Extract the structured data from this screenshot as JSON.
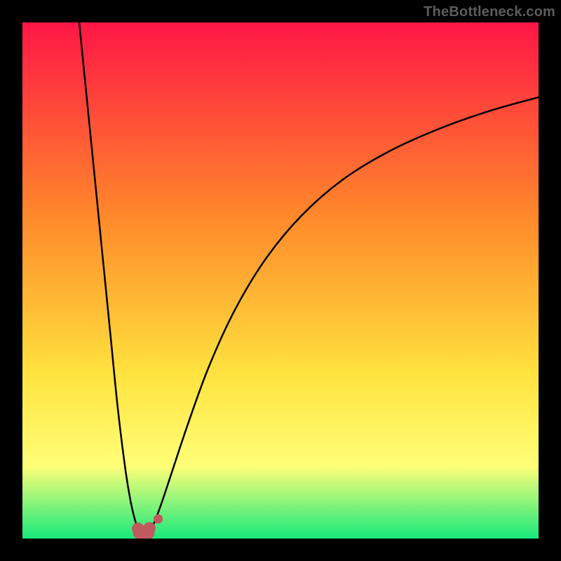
{
  "watermark": "TheBottleneck.com",
  "chart_data": {
    "type": "line",
    "title": "",
    "xlabel": "",
    "ylabel": "",
    "xlim": [
      0,
      100
    ],
    "ylim": [
      0,
      100
    ],
    "background_gradient": {
      "top": "#ff1646",
      "mid1": "#ff8a2a",
      "mid2": "#ffe23e",
      "mid3": "#ffff78",
      "bottom": "#17e97c"
    },
    "series": [
      {
        "name": "left-curve",
        "stroke": "#000000",
        "x": [
          11.0,
          13.0,
          15.0,
          17.0,
          18.5,
          20.0,
          21.0,
          21.7,
          22.3,
          22.7
        ],
        "values": [
          100.0,
          80.0,
          60.0,
          40.0,
          25.0,
          13.0,
          7.0,
          4.0,
          2.0,
          0.8
        ]
      },
      {
        "name": "right-curve",
        "stroke": "#000000",
        "x": [
          24.5,
          25.5,
          27.0,
          29.0,
          32.0,
          36.0,
          41.0,
          47.0,
          54.0,
          62.0,
          71.0,
          81.0,
          91.0,
          100.0
        ],
        "values": [
          1.0,
          3.0,
          7.0,
          13.0,
          22.0,
          33.0,
          44.0,
          54.0,
          62.5,
          69.5,
          75.0,
          79.5,
          83.0,
          85.5
        ]
      }
    ],
    "markers": {
      "name": "bottom-cluster",
      "fill": "#c05a5f",
      "points": [
        {
          "x": 22.4,
          "y": 1.9,
          "r": 1.2
        },
        {
          "x": 22.6,
          "y": 1.1,
          "r": 1.2
        },
        {
          "x": 23.0,
          "y": 0.7,
          "r": 1.2
        },
        {
          "x": 23.5,
          "y": 0.6,
          "r": 1.2
        },
        {
          "x": 24.0,
          "y": 0.7,
          "r": 1.2
        },
        {
          "x": 24.4,
          "y": 1.1,
          "r": 1.2
        },
        {
          "x": 24.6,
          "y": 2.0,
          "r": 1.2
        },
        {
          "x": 26.3,
          "y": 3.8,
          "r": 0.9
        }
      ]
    }
  }
}
